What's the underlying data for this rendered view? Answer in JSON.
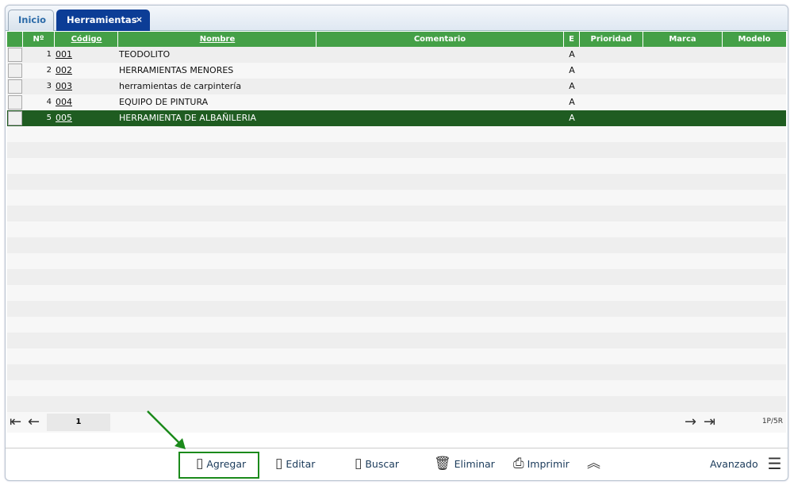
{
  "tabs": [
    {
      "label": "Inicio"
    },
    {
      "label": "Herramientas",
      "close": "×"
    }
  ],
  "columns": {
    "n": "Nº",
    "codigo": "Código",
    "nombre": "Nombre",
    "comentario": "Comentario",
    "e": "E",
    "prioridad": "Prioridad",
    "marca": "Marca",
    "modelo": "Modelo"
  },
  "rows": [
    {
      "n": "1",
      "codigo": "001",
      "nombre": "TEODOLITO",
      "e": "A"
    },
    {
      "n": "2",
      "codigo": "002",
      "nombre": "HERRAMIENTAS MENORES",
      "e": "A"
    },
    {
      "n": "3",
      "codigo": "003",
      "nombre": "herramientas de carpintería",
      "e": "A"
    },
    {
      "n": "4",
      "codigo": "004",
      "nombre": "EQUIPO DE PINTURA",
      "e": "A"
    },
    {
      "n": "5",
      "codigo": "005",
      "nombre": "HERRAMIENTA DE ALBAÑILERIA",
      "e": "A",
      "selected": true
    }
  ],
  "pager": {
    "page": "1",
    "info": "1P/5R"
  },
  "toolbar": {
    "agregar": "Agregar",
    "editar": "Editar",
    "buscar": "Buscar",
    "eliminar": "Eliminar",
    "imprimir": "Imprimir",
    "avanzado": "Avanzado"
  }
}
